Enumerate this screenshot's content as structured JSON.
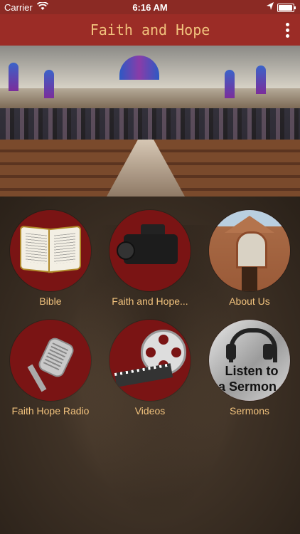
{
  "status_bar": {
    "carrier": "Carrier",
    "time": "6:16 AM"
  },
  "header": {
    "title": "Faith and Hope"
  },
  "banner": {
    "page_count": 2,
    "active_page": 2
  },
  "tiles": [
    {
      "label": "Bible",
      "icon": "open-bible-icon"
    },
    {
      "label": "Faith and Hope...",
      "icon": "video-camera-icon"
    },
    {
      "label": "About Us",
      "icon": "church-building-icon"
    },
    {
      "label": "Faith Hope Radio",
      "icon": "radio-microphone-icon"
    },
    {
      "label": "Videos",
      "icon": "film-reel-icon"
    },
    {
      "label": "Sermons",
      "icon": "headphones-sermon-icon"
    }
  ],
  "sermon_art": {
    "line1": "Listen to",
    "line2": "a Sermon"
  },
  "colors": {
    "header_bg": "#9b2c26",
    "title_text": "#f1c27d",
    "circle_bg": "#7a1414"
  }
}
